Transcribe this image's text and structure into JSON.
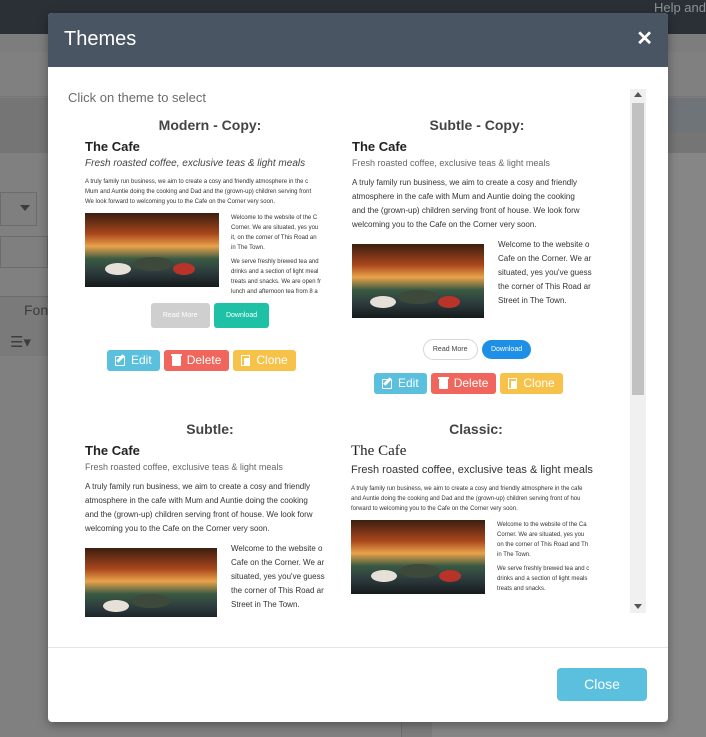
{
  "background": {
    "help_text": "Help and",
    "font_label": "Fon"
  },
  "modal": {
    "title": "Themes",
    "hint": "Click on theme to select",
    "close_label": "Close"
  },
  "themes": [
    {
      "heading": "Modern - Copy:",
      "cafe_title": "The Cafe",
      "tagline": "Fresh roasted coffee, exclusive teas & light meals",
      "paragraph_lines": [
        "A truly family run business, we aim to create a cosy and friendly atmosphere in the c",
        "Mum and Auntie doing the cooking and Dad and the (grown-up) children serving front",
        "We look forward to welcoming you to the Cafe on the Corner very soon."
      ],
      "side_lines": [
        "Welcome to the website of the C",
        "Corner. We are situated, yes you",
        "it, on the corner of This Road an",
        "in The Town.",
        "We serve freshly brewed tea and",
        "drinks and a section of light meal",
        "treats and snacks. We are open fr",
        "lunch and afternoon tea from 8 a"
      ],
      "read_more": "Read More",
      "download": "Download",
      "edit": "Edit",
      "delete": "Delete",
      "clone": "Clone"
    },
    {
      "heading": "Subtle - Copy:",
      "cafe_title": "The Cafe",
      "tagline": "Fresh roasted coffee, exclusive teas & light meals",
      "paragraph_lines": [
        "A truly family run business, we aim to create a cosy and friendly",
        "atmosphere in the cafe with Mum and Auntie doing the cooking",
        "and the (grown-up) children serving front of house. We look forw",
        "welcoming you to the Cafe on the Corner very soon."
      ],
      "side_lines": [
        "Welcome to the website o",
        "Cafe on the Corner. We ar",
        "situated, yes you've guess",
        "the corner of This Road ar",
        "Street in The Town."
      ],
      "read_more": "Read More",
      "download": "Download",
      "edit": "Edit",
      "delete": "Delete",
      "clone": "Clone"
    },
    {
      "heading": "Subtle:",
      "cafe_title": "The Cafe",
      "tagline": "Fresh roasted coffee, exclusive teas & light meals",
      "paragraph_lines": [
        "A truly family run business, we aim to create a cosy and friendly",
        "atmosphere in the cafe with Mum and Auntie doing the cooking",
        "and the (grown-up) children serving front of house. We look forw",
        "welcoming you to the Cafe on the Corner very soon."
      ],
      "side_lines": [
        "Welcome to the website o",
        "Cafe on the Corner. We ar",
        "situated, yes you've guess",
        "the corner of This Road ar",
        "Street in The Town."
      ]
    },
    {
      "heading": "Classic:",
      "cafe_title": "The Cafe",
      "tagline": "Fresh roasted coffee, exclusive teas & light meals",
      "paragraph_lines": [
        "A truly family run business, we aim to create a cosy and friendly atmosphere in the cafe",
        "and Auntie doing the cooking and Dad and the (grown-up) children serving front of hou",
        "forward to welcoming you to the Cafe on the Corner very soon."
      ],
      "side_lines": [
        "Welcome to the website of the Ca",
        "Corner. We are situated, yes you",
        "on the corner of This Road and Th",
        "in The Town.",
        "We serve freshly brewed tea and c",
        "drinks and a section of light meals",
        "treats and snacks."
      ]
    }
  ]
}
